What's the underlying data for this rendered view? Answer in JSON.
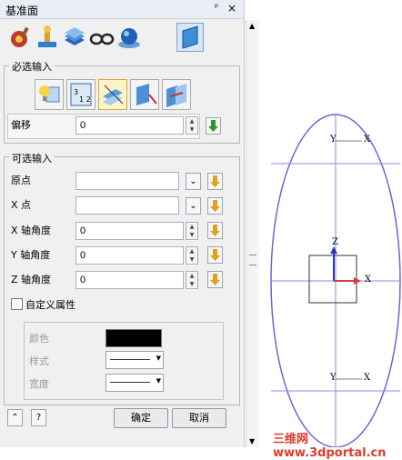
{
  "window": {
    "title": "基准面",
    "pin_glyph": "ᵖ",
    "close_glyph": "×"
  },
  "toolbar": {
    "icons": [
      "gear-brush-icon",
      "stamp-icon",
      "stacked-sheets-icon",
      "glasses-icon",
      "sphere-icon",
      "datum-plane-icon"
    ],
    "selected_index": 5
  },
  "required": {
    "legend": "必选输入",
    "plane_type_icons": [
      "bulb-plane-icon",
      "matrix-plane-icon",
      "angled-plane-icon",
      "normal-plane-icon",
      "offset-plane-icon"
    ],
    "selected_type": 2,
    "offset_label": "偏移",
    "offset_value": "0"
  },
  "optional": {
    "legend": "可选输入",
    "origin_label": "原点",
    "origin_value": "",
    "xpoint_label": "X 点",
    "xpoint_value": "",
    "x_angle_label": "X 轴角度",
    "x_angle_value": "0",
    "y_angle_label": "Y 轴角度",
    "y_angle_value": "0",
    "z_angle_label": "Z 轴角度",
    "z_angle_value": "0",
    "custom_attr_label": "自定义属性",
    "color_label": "颜色",
    "style_label": "样式",
    "width_label": "宽度",
    "colors": {
      "swatch": "#000000",
      "accent_arrow": "#2f9a2a",
      "stepper_arrow": "#e0a020"
    }
  },
  "footer": {
    "ok_label": "确定",
    "cancel_label": "取消"
  },
  "viewport": {
    "axis_labels": {
      "top_y": "Y",
      "top_x": "X",
      "center_z": "Z",
      "center_x": "X",
      "bottom_y": "Y",
      "bottom_x": "X"
    },
    "watermark": "三维网www.3dportal.cn",
    "colors": {
      "ellipse": "#6a66d9",
      "axis_line": "#8a8ae8",
      "z_axis": "#2e36c8",
      "x_axis": "#d83d3d"
    }
  }
}
